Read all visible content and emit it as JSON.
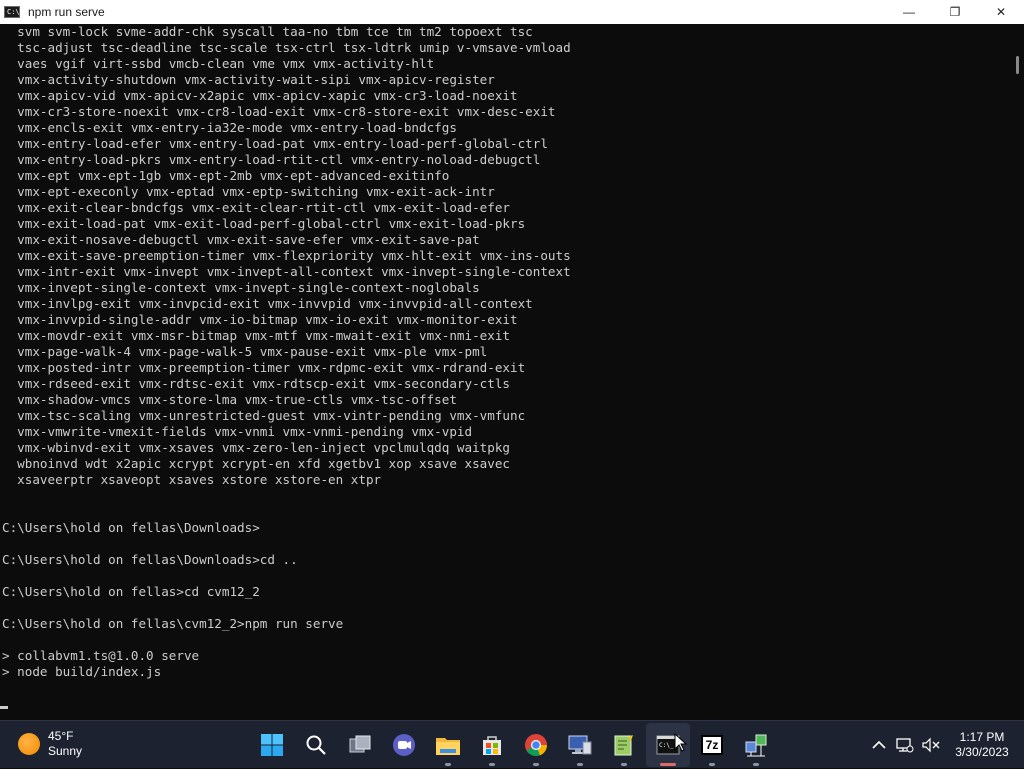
{
  "window": {
    "title": "npm run serve",
    "icon_text": "C:\\",
    "controls": {
      "minimize": "—",
      "maximize": "❐",
      "close": "✕"
    }
  },
  "terminal": {
    "lines": [
      "  svm svm-lock svme-addr-chk syscall taa-no tbm tce tm tm2 topoext tsc",
      "  tsc-adjust tsc-deadline tsc-scale tsx-ctrl tsx-ldtrk umip v-vmsave-vmload",
      "  vaes vgif virt-ssbd vmcb-clean vme vmx vmx-activity-hlt",
      "  vmx-activity-shutdown vmx-activity-wait-sipi vmx-apicv-register",
      "  vmx-apicv-vid vmx-apicv-x2apic vmx-apicv-xapic vmx-cr3-load-noexit",
      "  vmx-cr3-store-noexit vmx-cr8-load-exit vmx-cr8-store-exit vmx-desc-exit",
      "  vmx-encls-exit vmx-entry-ia32e-mode vmx-entry-load-bndcfgs",
      "  vmx-entry-load-efer vmx-entry-load-pat vmx-entry-load-perf-global-ctrl",
      "  vmx-entry-load-pkrs vmx-entry-load-rtit-ctl vmx-entry-noload-debugctl",
      "  vmx-ept vmx-ept-1gb vmx-ept-2mb vmx-ept-advanced-exitinfo",
      "  vmx-ept-execonly vmx-eptad vmx-eptp-switching vmx-exit-ack-intr",
      "  vmx-exit-clear-bndcfgs vmx-exit-clear-rtit-ctl vmx-exit-load-efer",
      "  vmx-exit-load-pat vmx-exit-load-perf-global-ctrl vmx-exit-load-pkrs",
      "  vmx-exit-nosave-debugctl vmx-exit-save-efer vmx-exit-save-pat",
      "  vmx-exit-save-preemption-timer vmx-flexpriority vmx-hlt-exit vmx-ins-outs",
      "  vmx-intr-exit vmx-invept vmx-invept-all-context vmx-invept-single-context",
      "  vmx-invept-single-context vmx-invept-single-context-noglobals",
      "  vmx-invlpg-exit vmx-invpcid-exit vmx-invvpid vmx-invvpid-all-context",
      "  vmx-invvpid-single-addr vmx-io-bitmap vmx-io-exit vmx-monitor-exit",
      "  vmx-movdr-exit vmx-msr-bitmap vmx-mtf vmx-mwait-exit vmx-nmi-exit",
      "  vmx-page-walk-4 vmx-page-walk-5 vmx-pause-exit vmx-ple vmx-pml",
      "  vmx-posted-intr vmx-preemption-timer vmx-rdpmc-exit vmx-rdrand-exit",
      "  vmx-rdseed-exit vmx-rdtsc-exit vmx-rdtscp-exit vmx-secondary-ctls",
      "  vmx-shadow-vmcs vmx-store-lma vmx-true-ctls vmx-tsc-offset",
      "  vmx-tsc-scaling vmx-unrestricted-guest vmx-vintr-pending vmx-vmfunc",
      "  vmx-vmwrite-vmexit-fields vmx-vnmi vmx-vnmi-pending vmx-vpid",
      "  vmx-wbinvd-exit vmx-xsaves vmx-zero-len-inject vpclmulqdq waitpkg",
      "  wbnoinvd wdt x2apic xcrypt xcrypt-en xfd xgetbv1 xop xsave xsavec",
      "  xsaveerptr xsaveopt xsaves xstore xstore-en xtpr",
      "",
      "",
      "C:\\Users\\hold on fellas\\Downloads>",
      "",
      "C:\\Users\\hold on fellas\\Downloads>cd ..",
      "",
      "C:\\Users\\hold on fellas>cd cvm12_2",
      "",
      "C:\\Users\\hold on fellas\\cvm12_2>npm run serve",
      "",
      "> collabvm1.ts@1.0.0 serve",
      "> node build/index.js"
    ]
  },
  "taskbar": {
    "weather": {
      "temp": "45°F",
      "condition": "Sunny"
    },
    "apps": [
      {
        "name": "start-button",
        "icon": "windows-logo-icon"
      },
      {
        "name": "search-button",
        "icon": "search-icon"
      },
      {
        "name": "task-view-button",
        "icon": "task-view-icon"
      },
      {
        "name": "teams-chat-button",
        "icon": "chat-icon"
      },
      {
        "name": "file-explorer-button",
        "icon": "folder-icon"
      },
      {
        "name": "microsoft-store-button",
        "icon": "store-icon"
      },
      {
        "name": "chrome-button",
        "icon": "chrome-icon"
      },
      {
        "name": "vm-app-button",
        "icon": "computer-icon"
      },
      {
        "name": "notepad-plus-button",
        "icon": "notepad-icon"
      },
      {
        "name": "command-prompt-button",
        "icon": "terminal-icon",
        "active": true
      },
      {
        "name": "7zip-button",
        "icon": "7zip-icon",
        "label": "7z"
      },
      {
        "name": "network-tool-button",
        "icon": "network-icon"
      }
    ],
    "clock": {
      "time": "1:17 PM",
      "date": "3/30/2023"
    }
  }
}
